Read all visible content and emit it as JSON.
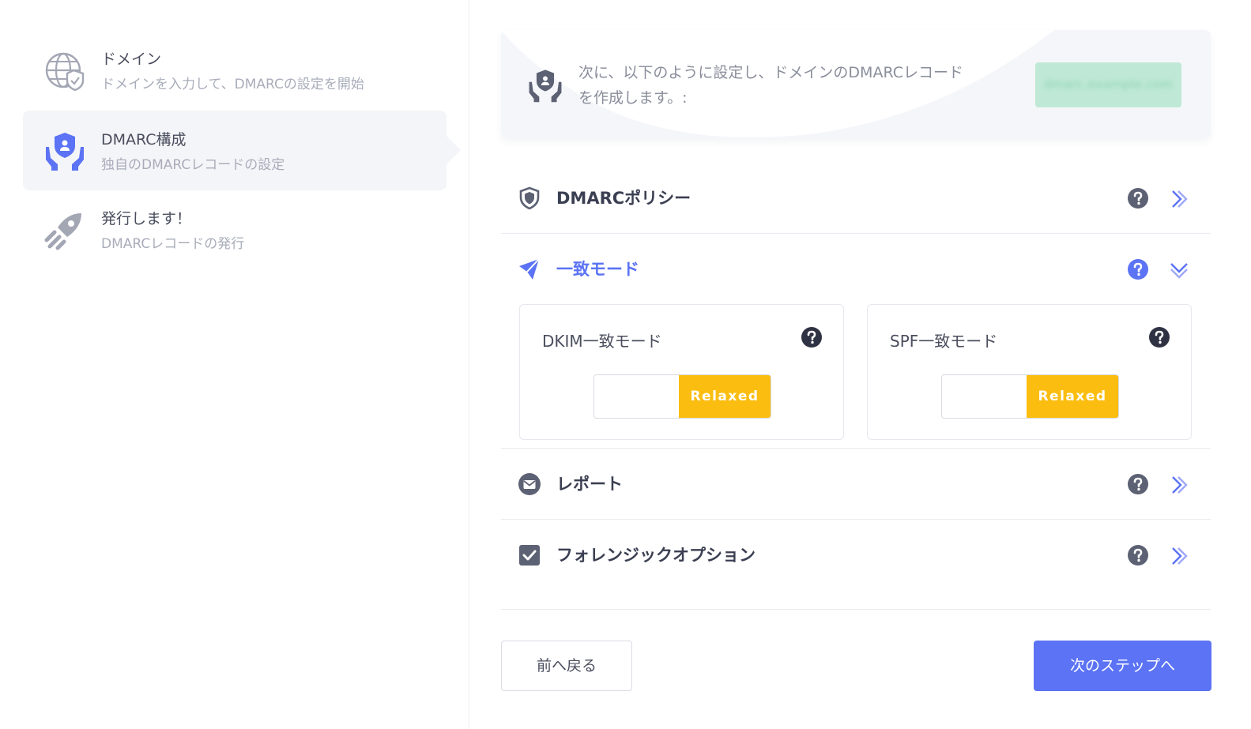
{
  "steps": [
    {
      "title": "ドメイン",
      "subtitle": "ドメインを入力して、DMARCの設定を開始",
      "icon": "globe-shield-icon",
      "active": false
    },
    {
      "title": "DMARC構成",
      "subtitle": "独自のDMARCレコードの設定",
      "icon": "hands-shield-icon",
      "active": true
    },
    {
      "title": "発行します！",
      "subtitle": "DMARCレコードの発行",
      "icon": "rocket-icon",
      "active": false
    }
  ],
  "banner": {
    "text": "次に、以下のように設定し、ドメインのDMARCレコードを作成します。:",
    "domain_pill": "dmarc.example.com",
    "icon": "hands-shield-icon"
  },
  "sections": {
    "policy": {
      "title": "DMARCポリシー",
      "icon": "shield-icon",
      "expanded": false
    },
    "alignment": {
      "title": "一致モード",
      "icon": "compass-icon",
      "expanded": true
    },
    "report": {
      "title": "レポート",
      "icon": "envelope-icon",
      "expanded": false
    },
    "forensic": {
      "title": "フォレンジックオプション",
      "icon": "checkbox-icon",
      "expanded": false
    }
  },
  "alignment_cards": {
    "dkim": {
      "title": "DKIM一致モード",
      "value": "Relaxed"
    },
    "spf": {
      "title": "SPF一致モード",
      "value": "Relaxed"
    }
  },
  "buttons": {
    "back": "前へ戻る",
    "next": "次のステップへ"
  },
  "colors": {
    "accent": "#5b73f4",
    "toggle_on": "#fbbd0f",
    "muted_icon": "#5c6173",
    "pill": "#bfe9d6"
  }
}
